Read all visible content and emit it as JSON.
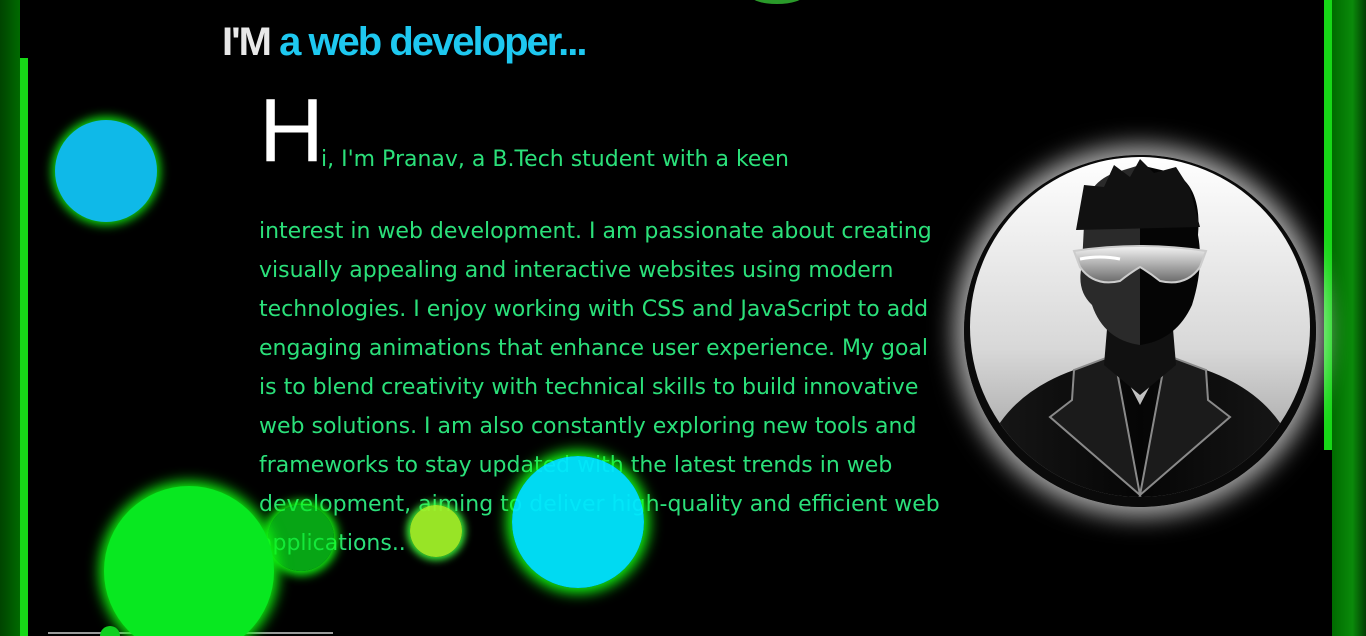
{
  "heading": {
    "prefix": "I'M",
    "role": "a web developer..."
  },
  "intro": {
    "drop_cap": "H",
    "first_line": "i, I'm Pranav, a B.Tech student with a keen",
    "body": "interest in web development. I am passionate about creating visually appealing and interactive websites using modern technologies. I enjoy working with CSS and JavaScript to add engaging animations that enhance user experience. My goal is to blend creativity with technical skills to build innovative web solutions. I am also constantly exploring new tools and frameworks to stay updated with the latest trends in web development, aiming to deliver high-quality and efficient web applications.."
  },
  "colors": {
    "heading_prefix": "#e8e8e8",
    "heading_role": "#1ec8f0",
    "body_text": "#2be07a",
    "drop_cap": "#ffffff",
    "frame_green": "#17d817",
    "bubble_blue": "#0fb9e8",
    "bubble_cyan": "#00e6ff",
    "bubble_green": "#08e820",
    "bubble_lime": "#a0f028"
  },
  "icons": {
    "avatar": "profile-avatar-silhouette-with-sunglasses"
  }
}
